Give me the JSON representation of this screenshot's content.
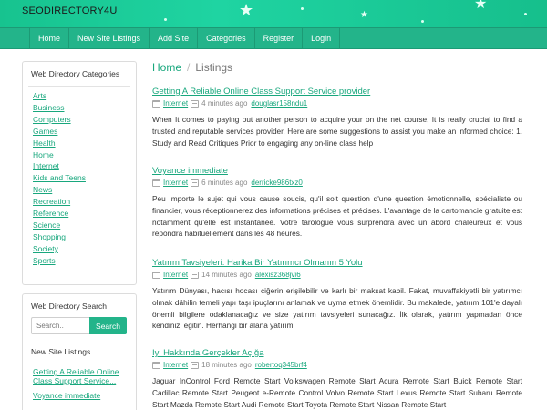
{
  "header": {
    "brand": "SEODIRECTORY4U"
  },
  "nav": [
    "Home",
    "New Site Listings",
    "Add Site",
    "Categories",
    "Register",
    "Login"
  ],
  "sidebar": {
    "categories_title": "Web Directory Categories",
    "categories": [
      "Arts",
      "Business",
      "Computers",
      "Games",
      "Health",
      "Home",
      "Internet",
      "Kids and Teens",
      "News",
      "Recreation",
      "Reference",
      "Science",
      "Shopping",
      "Society",
      "Sports"
    ],
    "search_title": "Web Directory Search",
    "search_placeholder": "Search..",
    "search_button": "Search",
    "new_listings_title": "New Site Listings",
    "new_listings": [
      "Getting A Reliable Online Class Support Service...",
      "Voyance immediate"
    ]
  },
  "breadcrumb": {
    "home": "Home",
    "sep": "/",
    "current": "Listings"
  },
  "listings": [
    {
      "title": "Getting A Reliable Online Class Support Service provider",
      "category": "Internet",
      "time": "4 minutes ago",
      "user": "douglasr158ndu1",
      "description": "When It comes to paying out another person to acquire your on the net course, It is really crucial to find a trusted and reputable services provider. Here are some suggestions to assist you make an informed choice: 1. Study and Read Critiques Prior to engaging any on-line class help"
    },
    {
      "title": "Voyance immediate",
      "category": "Internet",
      "time": "6 minutes ago",
      "user": "derricke986txz0",
      "description": "Peu Importe le sujet qui vous cause soucis, qu'il soit question d'une question émotionnelle, spécialiste ou financier, vous réceptionnerez des informations précises et précises. L'avantage de la cartomancie gratuite est notamment qu'elle est instantanée. Votre tarologue vous surprendra avec un abord chaleureux et vous répondra habituellement dans les 48 heures."
    },
    {
      "title": "Yatırım Tavsiyeleri: Harika Bir Yatırımcı Olmanın 5 Yolu",
      "category": "Internet",
      "time": "14 minutes ago",
      "user": "alexisz368jvi6",
      "description": "Yatırım Dünyası, hacısı hocası ciğerin erişilebilir ve karlı bir maksat kabil. Fakat, muvaffakiyetli bir yatırımcı olmak dâhilin temeli yapı taşı ipuçlarını anlamak ve uyma etmek önemlidir. Bu makalede, yatırım 101'e dayalı önemli bilgilere odaklanacağız ve size yatırım tavsiyeleri sunacağız. İlk olarak, yatırım yapmadan önce kendinizi eğitin. Herhangi bir alana yatırım"
    },
    {
      "title": "Iyi Hakkında Gerçekler Açığa",
      "category": "Internet",
      "time": "18 minutes ago",
      "user": "robertoq345brf4",
      "description": "Jaguar InControl Ford Remote Start Volkswagen Remote Start Acura Remote Start Buick Remote Start Cadillac Remote Start Peugeot e-Remote Control Volvo Remote Start Lexus Remote Start Subaru Remote Start Mazda Remote Start Audi Remote Start Toyota Remote Start Nissan Remote Start"
    }
  ]
}
